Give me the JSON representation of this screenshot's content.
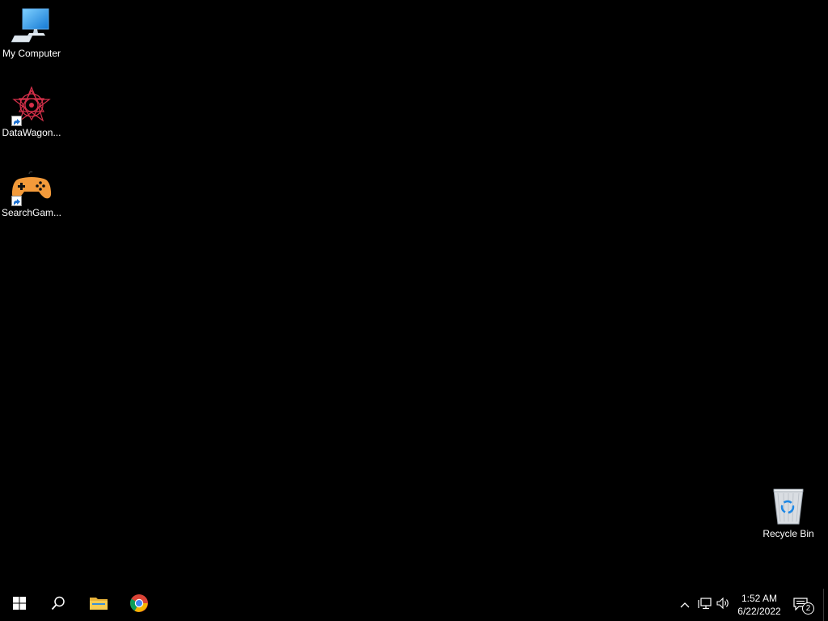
{
  "desktop": {
    "background_color": "#000000",
    "icons": [
      {
        "label": "My Computer",
        "icon": "computer-monitor-icon",
        "shortcut": false
      },
      {
        "label": "DataWagon...",
        "icon": "datawagon-app-icon",
        "shortcut": true
      },
      {
        "label": "SearchGam...",
        "icon": "gamepad-icon",
        "shortcut": true
      },
      {
        "label": "Recycle Bin",
        "icon": "recycle-bin-icon",
        "shortcut": false
      }
    ]
  },
  "taskbar": {
    "background_color": "#000000",
    "start_icon": "windows-logo-icon",
    "search_icon": "search-icon",
    "pinned": [
      {
        "name": "File Explorer",
        "icon": "folder-icon"
      },
      {
        "name": "Google Chrome",
        "icon": "chrome-icon"
      }
    ],
    "tray": {
      "overflow_icon": "chevron-up-icon",
      "network_icon": "network-icon",
      "volume_icon": "speaker-icon",
      "time": "1:52 AM",
      "date": "6/22/2022",
      "notifications_icon": "action-center-icon",
      "notification_count": "2"
    }
  }
}
